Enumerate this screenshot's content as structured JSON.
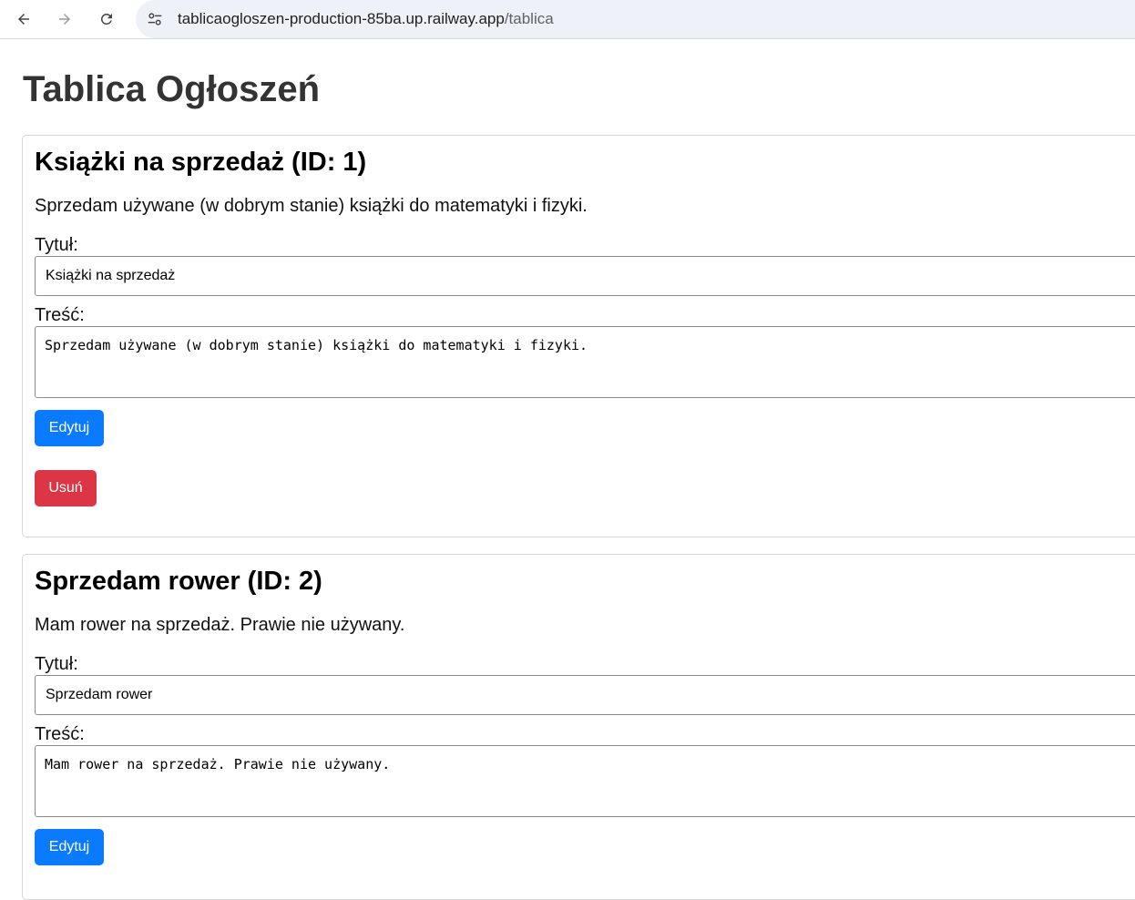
{
  "browser": {
    "url_host": "tablicaogloszen-production-85ba.up.railway.app",
    "url_path": "/tablica",
    "back_icon": "arrow-left-icon",
    "forward_icon": "arrow-right-icon",
    "reload_icon": "reload-icon",
    "site_info_icon": "tune-icon"
  },
  "page": {
    "title": "Tablica Ogłoszeń"
  },
  "announcements": [
    {
      "heading": "Książki na sprzedaż (ID: 1)",
      "description": "Sprzedam używane (w dobrym stanie) książki do matematyki i fizyki.",
      "title_label": "Tytuł:",
      "title_value": "Książki na sprzedaż",
      "content_label": "Treść:",
      "content_value": "Sprzedam używane (w dobrym stanie) książki do matematyki i fizyki.",
      "edit_label": "Edytuj",
      "delete_label": "Usuń"
    },
    {
      "heading": "Sprzedam rower (ID: 2)",
      "description": "Mam rower na sprzedaż. Prawie nie używany.",
      "title_label": "Tytuł:",
      "title_value": "Sprzedam rower",
      "content_label": "Treść:",
      "content_value": "Mam rower na sprzedaż. Prawie nie używany.",
      "edit_label": "Edytuj"
    }
  ],
  "colors": {
    "edit_button": "#0a7bff",
    "delete_button": "#dc3545",
    "address_bar": "#eef1f8"
  }
}
